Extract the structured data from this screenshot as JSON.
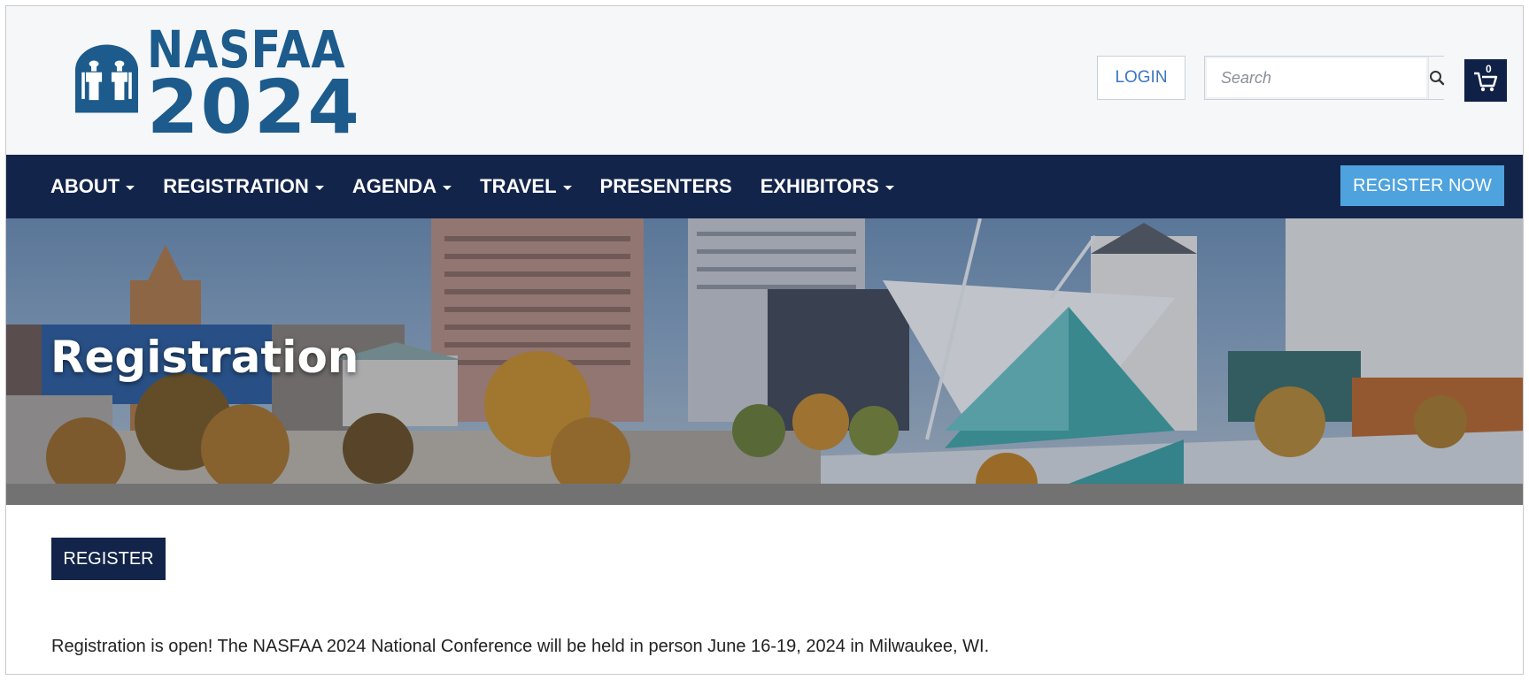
{
  "header": {
    "logo": {
      "line1": "NASFAA",
      "line2": "2024",
      "icon": "nasfaa-logo-icon",
      "brand_color": "#1c5b8c"
    },
    "login_label": "LOGIN",
    "search": {
      "placeholder": "Search",
      "icon": "search-icon"
    },
    "cart": {
      "icon": "cart-icon",
      "count": "0"
    }
  },
  "nav": {
    "items": [
      {
        "label": "ABOUT",
        "dropdown": true
      },
      {
        "label": "REGISTRATION",
        "dropdown": true
      },
      {
        "label": "AGENDA",
        "dropdown": true
      },
      {
        "label": "TRAVEL",
        "dropdown": true
      },
      {
        "label": "PRESENTERS",
        "dropdown": false
      },
      {
        "label": "EXHIBITORS",
        "dropdown": true
      }
    ],
    "cta_label": "REGISTER NOW",
    "bg_color": "#13244a",
    "cta_color": "#4ea2de"
  },
  "hero": {
    "title": "Registration"
  },
  "content": {
    "register_label": "REGISTER",
    "intro_text": "Registration is open! The NASFAA 2024 National Conference will be held in person June 16-19, 2024 in Milwaukee, WI."
  }
}
